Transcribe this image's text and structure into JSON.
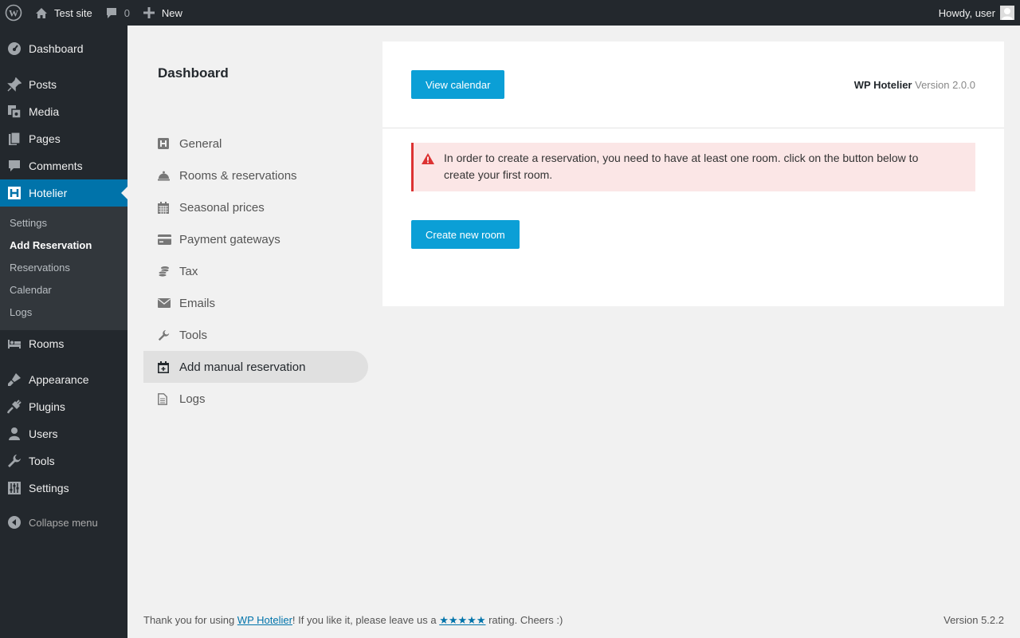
{
  "adminbar": {
    "site_name": "Test site",
    "comments_count": "0",
    "new_label": "New",
    "howdy": "Howdy, user"
  },
  "sidebar": {
    "items": [
      {
        "label": "Dashboard",
        "icon": "dashboard-icon"
      },
      {
        "label": "Posts",
        "icon": "pin-icon"
      },
      {
        "label": "Media",
        "icon": "media-icon"
      },
      {
        "label": "Pages",
        "icon": "pages-icon"
      },
      {
        "label": "Comments",
        "icon": "comment-icon"
      },
      {
        "label": "Hotelier",
        "icon": "hotelier-icon"
      },
      {
        "label": "Rooms",
        "icon": "bed-icon"
      },
      {
        "label": "Appearance",
        "icon": "brush-icon"
      },
      {
        "label": "Plugins",
        "icon": "plugin-icon"
      },
      {
        "label": "Users",
        "icon": "user-icon"
      },
      {
        "label": "Tools",
        "icon": "wrench-icon"
      },
      {
        "label": "Settings",
        "icon": "sliders-icon"
      }
    ],
    "submenu": [
      "Settings",
      "Add Reservation",
      "Reservations",
      "Calendar",
      "Logs"
    ],
    "collapse_label": "Collapse menu",
    "accent": "#0073aa"
  },
  "hotelier_nav": {
    "title": "Dashboard",
    "items": [
      {
        "label": "General",
        "icon": "h-square-icon"
      },
      {
        "label": "Rooms & reservations",
        "icon": "bell-icon"
      },
      {
        "label": "Seasonal prices",
        "icon": "calendar-grid-icon"
      },
      {
        "label": "Payment gateways",
        "icon": "credit-card-icon"
      },
      {
        "label": "Tax",
        "icon": "coins-icon"
      },
      {
        "label": "Emails",
        "icon": "envelope-icon"
      },
      {
        "label": "Tools",
        "icon": "wrench-icon"
      },
      {
        "label": "Add manual reservation",
        "icon": "calendar-plus-icon"
      },
      {
        "label": "Logs",
        "icon": "file-icon"
      }
    ]
  },
  "panel": {
    "view_calendar": "View calendar",
    "plugin_name": "WP Hotelier",
    "version": "Version 2.0.0",
    "notice": "In order to create a reservation, you need to have at least one room. click on the button below to create your first room.",
    "create_room": "Create new room",
    "button_color": "#0b9fd6",
    "error_color": "#dc3232"
  },
  "footer": {
    "text_before": "Thank you for using ",
    "link": "WP Hotelier",
    "text_mid": "! If you like it, please leave us a ",
    "stars": "★★★★★",
    "text_after": " rating. Cheers :)",
    "version": "Version 5.2.2"
  }
}
